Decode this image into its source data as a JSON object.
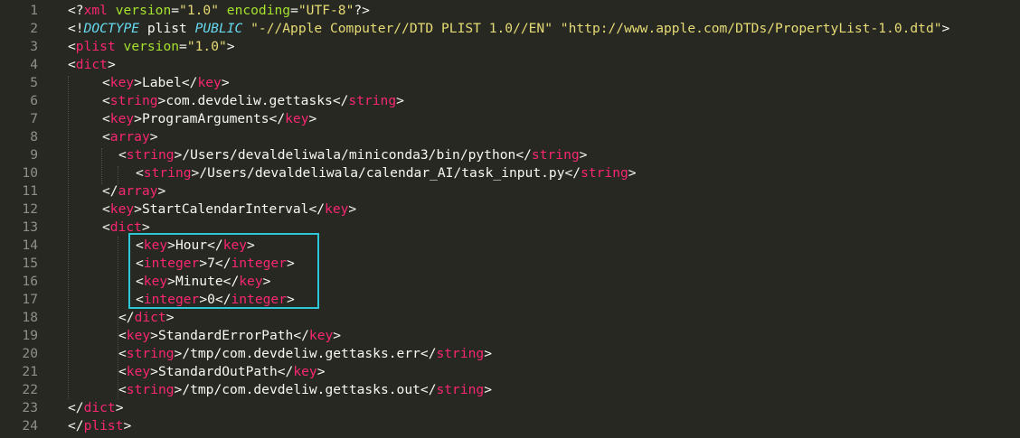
{
  "editor": {
    "language": "xml",
    "theme_colors": {
      "background": "#272822",
      "line_number": "#90908a",
      "tag": "#f92672",
      "attribute": "#a6e22e",
      "string": "#e6db74",
      "keyword": "#66d9ef",
      "text": "#f8f8f2",
      "highlight_box": "#2cc6d6"
    },
    "highlighted_lines": [
      14,
      17
    ],
    "lines": [
      {
        "n": "1",
        "indent": 0,
        "tokens": [
          [
            "punct",
            "<?"
          ],
          [
            "tag",
            "xml"
          ],
          [
            "txt",
            " "
          ],
          [
            "attr",
            "version"
          ],
          [
            "punct",
            "="
          ],
          [
            "str",
            "\"1.0\""
          ],
          [
            "txt",
            " "
          ],
          [
            "attr",
            "encoding"
          ],
          [
            "punct",
            "="
          ],
          [
            "str",
            "\"UTF-8\""
          ],
          [
            "punct",
            "?>"
          ]
        ]
      },
      {
        "n": "2",
        "indent": 0,
        "tokens": [
          [
            "punct",
            "<!"
          ],
          [
            "kw",
            "DOCTYPE"
          ],
          [
            "txt",
            " plist "
          ],
          [
            "kw",
            "PUBLIC"
          ],
          [
            "txt",
            " "
          ],
          [
            "str",
            "\"-//Apple Computer//DTD PLIST 1.0//EN\""
          ],
          [
            "txt",
            " "
          ],
          [
            "str",
            "\"http://www.apple.com/DTDs/PropertyList-1.0.dtd\""
          ],
          [
            "punct",
            ">"
          ]
        ]
      },
      {
        "n": "3",
        "indent": 0,
        "tokens": [
          [
            "punct",
            "<"
          ],
          [
            "tag",
            "plist"
          ],
          [
            "txt",
            " "
          ],
          [
            "attr",
            "version"
          ],
          [
            "punct",
            "="
          ],
          [
            "str",
            "\"1.0\""
          ],
          [
            "punct",
            ">"
          ]
        ]
      },
      {
        "n": "4",
        "indent": 0,
        "tokens": [
          [
            "punct",
            "<"
          ],
          [
            "tag",
            "dict"
          ],
          [
            "punct",
            ">"
          ]
        ]
      },
      {
        "n": "5",
        "indent": 1,
        "tokens": [
          [
            "punct",
            "<"
          ],
          [
            "tag",
            "key"
          ],
          [
            "punct",
            ">"
          ],
          [
            "txt",
            "Label"
          ],
          [
            "punct",
            "</"
          ],
          [
            "tag",
            "key"
          ],
          [
            "punct",
            ">"
          ]
        ]
      },
      {
        "n": "6",
        "indent": 1,
        "tokens": [
          [
            "punct",
            "<"
          ],
          [
            "tag",
            "string"
          ],
          [
            "punct",
            ">"
          ],
          [
            "txt",
            "com.devdeliw.gettasks"
          ],
          [
            "punct",
            "</"
          ],
          [
            "tag",
            "string"
          ],
          [
            "punct",
            ">"
          ]
        ]
      },
      {
        "n": "7",
        "indent": 1,
        "tokens": [
          [
            "punct",
            "<"
          ],
          [
            "tag",
            "key"
          ],
          [
            "punct",
            ">"
          ],
          [
            "txt",
            "ProgramArguments"
          ],
          [
            "punct",
            "</"
          ],
          [
            "tag",
            "key"
          ],
          [
            "punct",
            ">"
          ]
        ]
      },
      {
        "n": "8",
        "indent": 1,
        "tokens": [
          [
            "punct",
            "<"
          ],
          [
            "tag",
            "array"
          ],
          [
            "punct",
            ">"
          ]
        ]
      },
      {
        "n": "9",
        "indent": 2,
        "tokens": [
          [
            "punct",
            "<"
          ],
          [
            "tag",
            "string"
          ],
          [
            "punct",
            ">"
          ],
          [
            "txt",
            "/Users/devaldeliwala/miniconda3/bin/python"
          ],
          [
            "punct",
            "</"
          ],
          [
            "tag",
            "string"
          ],
          [
            "punct",
            ">"
          ]
        ]
      },
      {
        "n": "10",
        "indent": 3,
        "tokens": [
          [
            "punct",
            "<"
          ],
          [
            "tag",
            "string"
          ],
          [
            "punct",
            ">"
          ],
          [
            "txt",
            "/Users/devaldeliwala/calendar_AI/task_input.py"
          ],
          [
            "punct",
            "</"
          ],
          [
            "tag",
            "string"
          ],
          [
            "punct",
            ">"
          ]
        ]
      },
      {
        "n": "11",
        "indent": 1,
        "tokens": [
          [
            "punct",
            "</"
          ],
          [
            "tag",
            "array"
          ],
          [
            "punct",
            ">"
          ]
        ]
      },
      {
        "n": "12",
        "indent": 1,
        "tokens": [
          [
            "punct",
            "<"
          ],
          [
            "tag",
            "key"
          ],
          [
            "punct",
            ">"
          ],
          [
            "txt",
            "StartCalendarInterval"
          ],
          [
            "punct",
            "</"
          ],
          [
            "tag",
            "key"
          ],
          [
            "punct",
            ">"
          ]
        ]
      },
      {
        "n": "13",
        "indent": 1,
        "tokens": [
          [
            "punct",
            "<"
          ],
          [
            "tag",
            "dict"
          ],
          [
            "punct",
            ">"
          ]
        ]
      },
      {
        "n": "14",
        "indent": 3,
        "tokens": [
          [
            "punct",
            "<"
          ],
          [
            "tag",
            "key"
          ],
          [
            "punct",
            ">"
          ],
          [
            "txt",
            "Hour"
          ],
          [
            "punct",
            "</"
          ],
          [
            "tag",
            "key"
          ],
          [
            "punct",
            ">"
          ]
        ]
      },
      {
        "n": "15",
        "indent": 3,
        "tokens": [
          [
            "punct",
            "<"
          ],
          [
            "tag",
            "integer"
          ],
          [
            "punct",
            ">"
          ],
          [
            "txt",
            "7"
          ],
          [
            "punct",
            "</"
          ],
          [
            "tag",
            "integer"
          ],
          [
            "punct",
            ">"
          ]
        ]
      },
      {
        "n": "16",
        "indent": 3,
        "tokens": [
          [
            "punct",
            "<"
          ],
          [
            "tag",
            "key"
          ],
          [
            "punct",
            ">"
          ],
          [
            "txt",
            "Minute"
          ],
          [
            "punct",
            "</"
          ],
          [
            "tag",
            "key"
          ],
          [
            "punct",
            ">"
          ]
        ]
      },
      {
        "n": "17",
        "indent": 3,
        "tokens": [
          [
            "punct",
            "<"
          ],
          [
            "tag",
            "integer"
          ],
          [
            "punct",
            ">"
          ],
          [
            "txt",
            "0"
          ],
          [
            "punct",
            "</"
          ],
          [
            "tag",
            "integer"
          ],
          [
            "punct",
            ">"
          ]
        ]
      },
      {
        "n": "18",
        "indent": 2,
        "tokens": [
          [
            "punct",
            "</"
          ],
          [
            "tag",
            "dict"
          ],
          [
            "punct",
            ">"
          ]
        ]
      },
      {
        "n": "19",
        "indent": 2,
        "tokens": [
          [
            "punct",
            "<"
          ],
          [
            "tag",
            "key"
          ],
          [
            "punct",
            ">"
          ],
          [
            "txt",
            "StandardErrorPath"
          ],
          [
            "punct",
            "</"
          ],
          [
            "tag",
            "key"
          ],
          [
            "punct",
            ">"
          ]
        ]
      },
      {
        "n": "20",
        "indent": 2,
        "tokens": [
          [
            "punct",
            "<"
          ],
          [
            "tag",
            "string"
          ],
          [
            "punct",
            ">"
          ],
          [
            "txt",
            "/tmp/com.devdeliw.gettasks.err"
          ],
          [
            "punct",
            "</"
          ],
          [
            "tag",
            "string"
          ],
          [
            "punct",
            ">"
          ]
        ]
      },
      {
        "n": "21",
        "indent": 2,
        "tokens": [
          [
            "punct",
            "<"
          ],
          [
            "tag",
            "key"
          ],
          [
            "punct",
            ">"
          ],
          [
            "txt",
            "StandardOutPath"
          ],
          [
            "punct",
            "</"
          ],
          [
            "tag",
            "key"
          ],
          [
            "punct",
            ">"
          ]
        ]
      },
      {
        "n": "22",
        "indent": 2,
        "tokens": [
          [
            "punct",
            "<"
          ],
          [
            "tag",
            "string"
          ],
          [
            "punct",
            ">"
          ],
          [
            "txt",
            "/tmp/com.devdeliw.gettasks.out"
          ],
          [
            "punct",
            "</"
          ],
          [
            "tag",
            "string"
          ],
          [
            "punct",
            ">"
          ]
        ]
      },
      {
        "n": "23",
        "indent": 0,
        "tokens": [
          [
            "punct",
            "</"
          ],
          [
            "tag",
            "dict"
          ],
          [
            "punct",
            ">"
          ]
        ]
      },
      {
        "n": "24",
        "indent": 0,
        "tokens": [
          [
            "punct",
            "</"
          ],
          [
            "tag",
            "plist"
          ],
          [
            "punct",
            ">"
          ]
        ]
      }
    ]
  }
}
